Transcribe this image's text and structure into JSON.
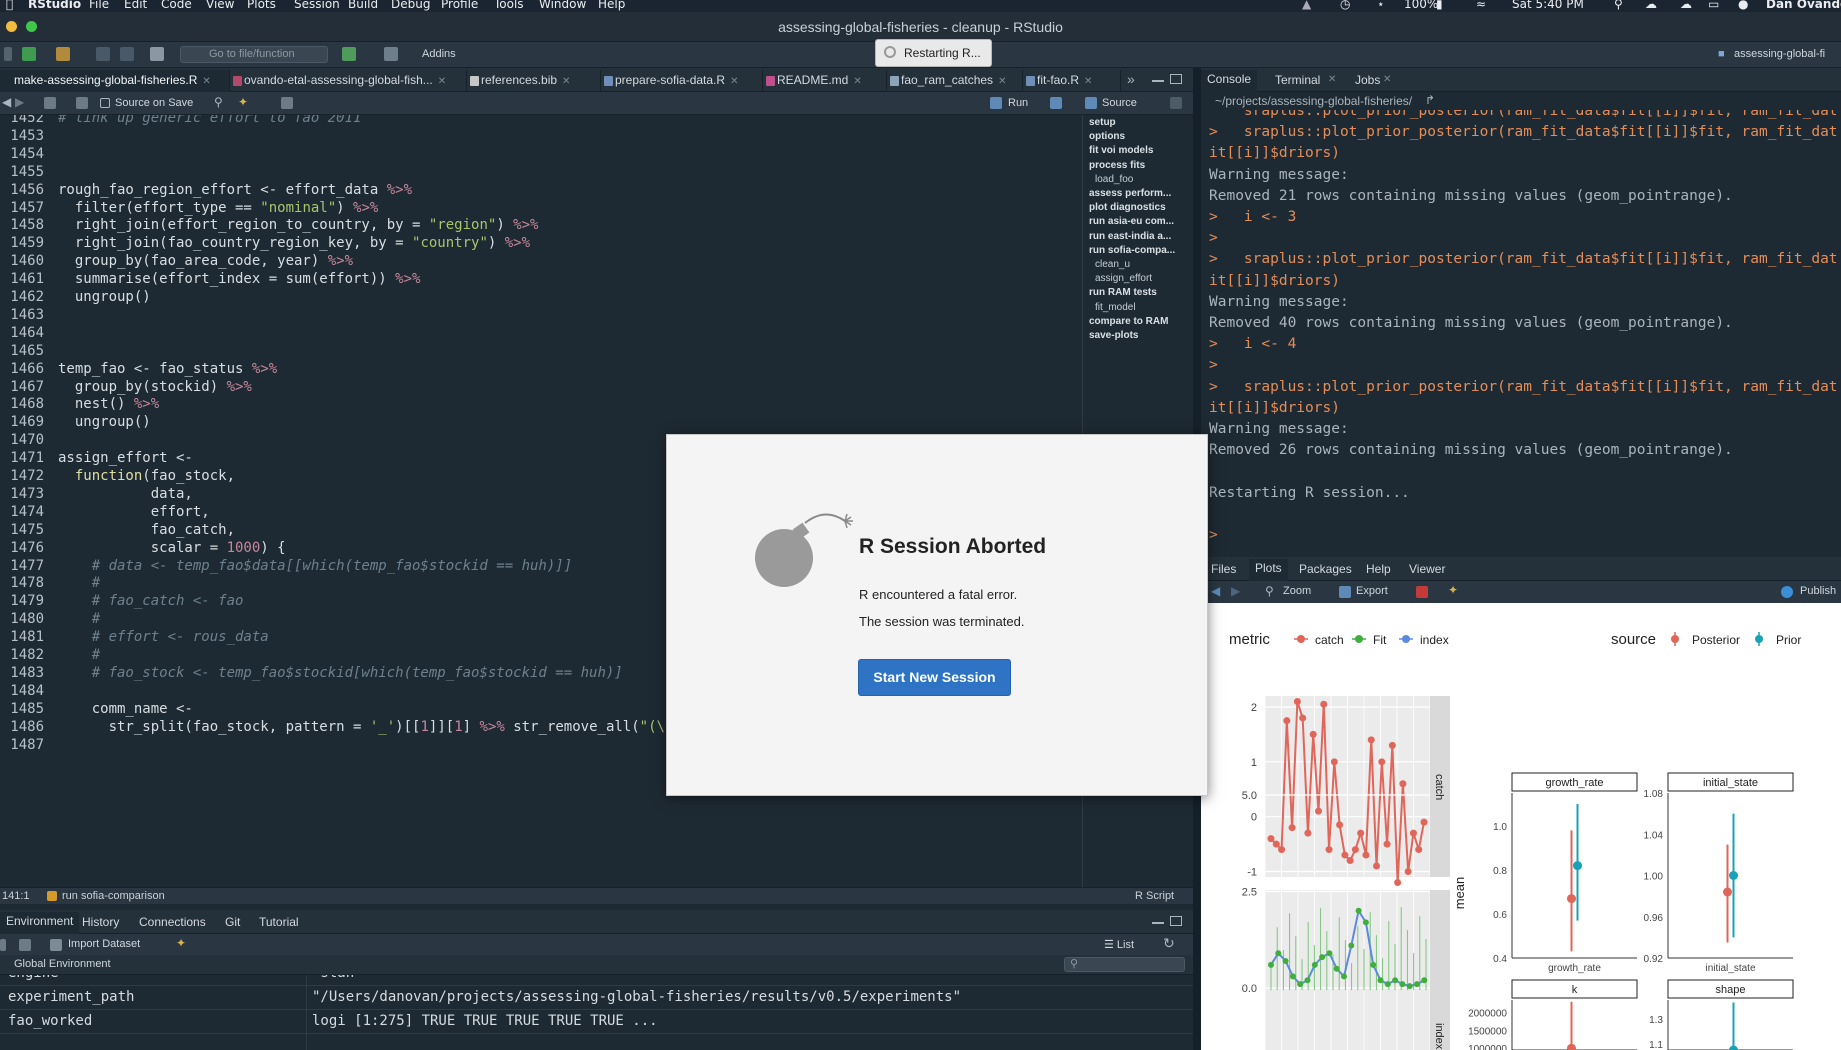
{
  "menubar": {
    "app": "RStudio",
    "items": [
      "File",
      "Edit",
      "Code",
      "View",
      "Plots",
      "Session",
      "Build",
      "Debug",
      "Profile",
      "Tools",
      "Window",
      "Help"
    ],
    "battery": "100%",
    "clock": "Sat 5:40 PM",
    "user": "Dan Ovando"
  },
  "window": {
    "title": "assessing-global-fisheries - cleanup - RStudio"
  },
  "toolbar": {
    "goto_placeholder": "Go to file/function",
    "addins": "Addins",
    "restart_tooltip": "Restarting R...",
    "project": "assessing-global-fi"
  },
  "editor": {
    "tabs": [
      {
        "label": "make-assessing-global-fisheries.R",
        "active": true
      },
      {
        "label": "ovando-etal-assessing-global-fish..."
      },
      {
        "label": "references.bib"
      },
      {
        "label": "prepare-sofia-data.R"
      },
      {
        "label": "README.md"
      },
      {
        "label": "fao_ram_catches"
      },
      {
        "label": "fit-fao.R"
      }
    ],
    "source_on_save": "Source on Save",
    "run": "Run",
    "source": "Source",
    "lines": [
      {
        "n": "1452",
        "t": "# link up generic effort to fao 2011",
        "cls": "cm"
      },
      {
        "n": "1453",
        "t": ""
      },
      {
        "n": "1454",
        "t": ""
      },
      {
        "n": "1455",
        "t": ""
      },
      {
        "n": "1456",
        "t": "rough_fao_region_effort <- effort_data %>%"
      },
      {
        "n": "1457",
        "t": "  filter(effort_type == \"nominal\") %>%"
      },
      {
        "n": "1458",
        "t": "  right_join(effort_region_to_country, by = \"region\") %>%"
      },
      {
        "n": "1459",
        "t": "  right_join(fao_country_region_key, by = \"country\") %>%"
      },
      {
        "n": "1460",
        "t": "  group_by(fao_area_code, year) %>%"
      },
      {
        "n": "1461",
        "t": "  summarise(effort_index = sum(effort)) %>%"
      },
      {
        "n": "1462",
        "t": "  ungroup()"
      },
      {
        "n": "1463",
        "t": ""
      },
      {
        "n": "1464",
        "t": ""
      },
      {
        "n": "1465",
        "t": ""
      },
      {
        "n": "1466",
        "t": "temp_fao <- fao_status %>%"
      },
      {
        "n": "1467",
        "t": "  group_by(stockid) %>%"
      },
      {
        "n": "1468",
        "t": "  nest() %>%"
      },
      {
        "n": "1469",
        "t": "  ungroup()"
      },
      {
        "n": "1470",
        "t": ""
      },
      {
        "n": "1471",
        "t": "assign_effort <-"
      },
      {
        "n": "1472",
        "t": "  function(fao_stock,"
      },
      {
        "n": "1473",
        "t": "           data,"
      },
      {
        "n": "1474",
        "t": "           effort,"
      },
      {
        "n": "1475",
        "t": "           fao_catch,"
      },
      {
        "n": "1476",
        "t": "           scalar = 1000) {"
      },
      {
        "n": "1477",
        "t": "    # data <- temp_fao$data[[which(temp_fao$stockid == huh)]]",
        "cls": "cm"
      },
      {
        "n": "1478",
        "t": "    #",
        "cls": "cm"
      },
      {
        "n": "1479",
        "t": "    # fao_catch <- fao",
        "cls": "cm"
      },
      {
        "n": "1480",
        "t": "    #",
        "cls": "cm"
      },
      {
        "n": "1481",
        "t": "    # effort <- rous_data",
        "cls": "cm"
      },
      {
        "n": "1482",
        "t": "    #",
        "cls": "cm"
      },
      {
        "n": "1483",
        "t": "    # fao_stock <- temp_fao$stockid[which(temp_fao$stockid == huh)]",
        "cls": "cm"
      },
      {
        "n": "1484",
        "t": ""
      },
      {
        "n": "1485",
        "t": "    comm_name <-"
      },
      {
        "n": "1486",
        "t": "      str_split(fao_stock, pattern = '_')[[1]][1] %>% str_remove_all(\"(\\\\d)|(-)\")"
      },
      {
        "n": "1487",
        "t": ""
      }
    ],
    "outline": [
      {
        "label": "setup"
      },
      {
        "label": "options"
      },
      {
        "label": "fit voi models"
      },
      {
        "label": "process fits"
      },
      {
        "label": "load_foo",
        "sub": true
      },
      {
        "label": "assess perform..."
      },
      {
        "label": "plot diagnostics"
      },
      {
        "label": "run asia-eu com..."
      },
      {
        "label": "run east-india a..."
      },
      {
        "label": "run sofia-compa..."
      },
      {
        "label": "clean_u",
        "sub": true
      },
      {
        "label": "assign_effort",
        "sub": true
      },
      {
        "label": "run RAM tests"
      },
      {
        "label": "fit_model",
        "sub": true
      },
      {
        "label": "compare to RAM"
      },
      {
        "label": "save-plots"
      }
    ],
    "status_pos": "141:1",
    "status_section": "run sofia-comparison",
    "status_lang": "R Script"
  },
  "env": {
    "tabs": [
      "Environment",
      "History",
      "Connections",
      "Git",
      "Tutorial"
    ],
    "import": "Import Dataset",
    "list": "List",
    "scope": "Global Environment",
    "rows": [
      {
        "k": "engine",
        "v": "\"stan\""
      },
      {
        "k": "experiment_path",
        "v": "\"/Users/danovan/projects/assessing-global-fisheries/results/v0.5/experiments\""
      },
      {
        "k": "fao_worked",
        "v": "logi [1:275] TRUE TRUE TRUE TRUE TRUE ..."
      }
    ]
  },
  "console": {
    "tabs": [
      "Console",
      "Terminal",
      "Jobs"
    ],
    "path": "~/projects/assessing-global-fisheries/",
    "lines": [
      {
        "t": "    sraplus::plot_prior_posterior(ram_fit_data$fit[[i]]$fit, ram_fit_dat",
        "c": "cin"
      },
      {
        "t": ">   sraplus::plot_prior_posterior(ram_fit_data$fit[[i]]$fit, ram_fit_dat",
        "c": "cin"
      },
      {
        "t": "it[[i]]$driors)",
        "c": "cin"
      },
      {
        "t": "Warning message:",
        "c": "cmsg"
      },
      {
        "t": "Removed 21 rows containing missing values (geom_pointrange).",
        "c": "cmsg"
      },
      {
        "t": ">   i <- 3",
        "c": "cin"
      },
      {
        "t": ">",
        "c": "cin"
      },
      {
        "t": ">   sraplus::plot_prior_posterior(ram_fit_data$fit[[i]]$fit, ram_fit_dat",
        "c": "cin"
      },
      {
        "t": "it[[i]]$driors)",
        "c": "cin"
      },
      {
        "t": "Warning message:",
        "c": "cmsg"
      },
      {
        "t": "Removed 40 rows containing missing values (geom_pointrange).",
        "c": "cmsg"
      },
      {
        "t": ">   i <- 4",
        "c": "cin"
      },
      {
        "t": ">",
        "c": "cin"
      },
      {
        "t": ">   sraplus::plot_prior_posterior(ram_fit_data$fit[[i]]$fit, ram_fit_dat",
        "c": "cin"
      },
      {
        "t": "it[[i]]$driors)",
        "c": "cin"
      },
      {
        "t": "Warning message:",
        "c": "cmsg"
      },
      {
        "t": "Removed 26 rows containing missing values (geom_pointrange).",
        "c": "cmsg"
      },
      {
        "t": "",
        "c": "cmsg"
      },
      {
        "t": "Restarting R session...",
        "c": "cmsg"
      },
      {
        "t": "",
        "c": "cmsg"
      },
      {
        "t": ">",
        "c": "cin"
      }
    ]
  },
  "viewer": {
    "tabs": [
      "Files",
      "Plots",
      "Packages",
      "Help",
      "Viewer"
    ],
    "zoom": "Zoom",
    "export": "Export",
    "publish": "Publish"
  },
  "modal": {
    "title": "R Session Aborted",
    "msg1": "R encountered a fatal error.",
    "msg2": "The session was terminated.",
    "button": "Start New Session"
  },
  "chart_data": {
    "type": "scatter",
    "legends": {
      "metric": {
        "title": "metric",
        "items": [
          {
            "name": "catch",
            "color": "#e0665a"
          },
          {
            "name": "Fit",
            "color": "#3fae3f"
          },
          {
            "name": "index",
            "color": "#5a8ae0"
          }
        ]
      },
      "source": {
        "title": "source",
        "items": [
          {
            "name": "Posterior",
            "color": "#e0665a"
          },
          {
            "name": "Prior",
            "color": "#17a2b8"
          }
        ]
      }
    },
    "ylabel": "mean",
    "catch_panel": {
      "strip": "catch",
      "yticks": [
        "2",
        "1",
        "0",
        "-1"
      ],
      "ylim": [
        -1.1,
        2.2
      ],
      "values": [
        -0.4,
        -0.5,
        -0.6,
        1.75,
        -0.2,
        2.1,
        1.8,
        -0.3,
        1.5,
        0.1,
        2.05,
        -0.6,
        1.0,
        -0.15,
        -0.7,
        -0.8,
        -0.6,
        -0.3,
        -0.7,
        1.4,
        -0.9,
        1.0,
        -0.5,
        1.3,
        -1.2,
        0.6,
        -1.0,
        -0.3,
        -0.6,
        -0.1
      ]
    },
    "index_panel": {
      "strip": "index",
      "yticks": [
        "5.0",
        "2.5",
        "0.0"
      ],
      "ylim": [
        -0.3,
        5.0
      ]
    },
    "facets": [
      {
        "strip": "growth_rate",
        "xlabel": "growth_rate",
        "yticks": [
          "1.0",
          "0.8",
          "0.6",
          "0.4"
        ],
        "ylim": [
          0.4,
          1.15
        ],
        "posterior": {
          "mean": 0.67,
          "lo": 0.43,
          "hi": 0.98
        },
        "prior": {
          "mean": 0.82,
          "lo": 0.57,
          "hi": 1.1
        }
      },
      {
        "strip": "initial_state",
        "xlabel": "initial_state",
        "yticks": [
          "1.08",
          "1.04",
          "1.00",
          "0.96",
          "0.92"
        ],
        "ylim": [
          0.92,
          1.08
        ],
        "posterior": {
          "mean": 0.984,
          "lo": 0.935,
          "hi": 1.03
        },
        "prior": {
          "mean": 1.0,
          "lo": 0.94,
          "hi": 1.06
        }
      },
      {
        "strip": "k",
        "xlabel": "",
        "yticks": [
          "2000000",
          "1500000",
          "1000000"
        ],
        "ylim": [
          950000,
          2350000
        ],
        "posterior": {
          "mean": 1000000,
          "lo": 970000,
          "hi": 2300000
        }
      },
      {
        "strip": "shape",
        "xlabel": "",
        "yticks": [
          "1.3",
          "1.1"
        ],
        "ylim": [
          1.05,
          1.45
        ],
        "prior": {
          "mean": 1.05,
          "lo": 1.05,
          "hi": 1.43
        }
      }
    ]
  }
}
